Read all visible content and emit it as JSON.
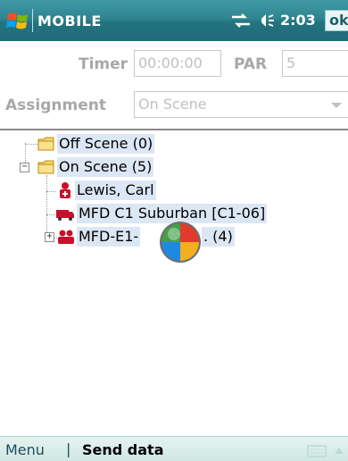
{
  "titlebar": {
    "app_title": "MOBILE",
    "clock": "2:03",
    "ok_label": "ok",
    "start_icon": "windows-flag-icon",
    "network_icon": "network-sync-icon",
    "volume_icon": "volume-icon"
  },
  "form": {
    "timer_label": "Timer",
    "timer_value": "00:00:00",
    "par_label": "PAR",
    "par_value": "5",
    "assignment_label": "Assignment",
    "assignment_value": "On Scene"
  },
  "tree": {
    "nodes": [
      {
        "label": "Off Scene (0)",
        "icon": "folder-icon"
      },
      {
        "label": "On Scene (5)",
        "icon": "folder-icon",
        "expander": "−"
      },
      {
        "label": "Lewis, Carl",
        "icon": "person-icon"
      },
      {
        "label": "MFD C1 Suburban [C1-06]",
        "icon": "vehicle-icon"
      },
      {
        "label": "MFD-E1-",
        "label_tail": ". (4)",
        "icon": "crew-icon",
        "expander": "+"
      }
    ]
  },
  "menubar": {
    "left": "Menu",
    "separator": "|",
    "right": "Send data"
  },
  "colors": {
    "titlebar": "#227380",
    "selection": "#dce7f5",
    "menubar": "#cfe7e3"
  }
}
